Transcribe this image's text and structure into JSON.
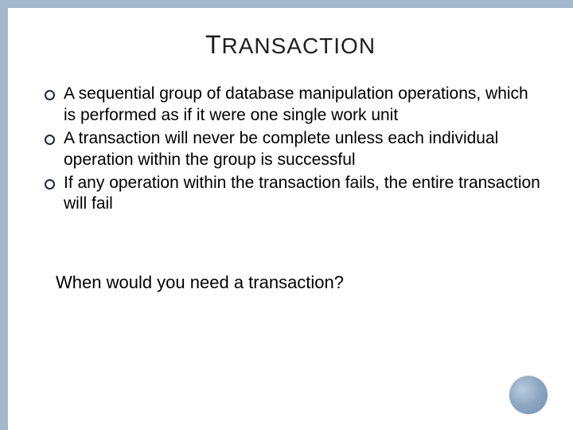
{
  "title": {
    "first_letter": "T",
    "rest": "RANSACTION"
  },
  "bullets": [
    "A sequential group of database manipulation operations, which is performed as if it were one single work unit",
    "A transaction will never be complete unless each individual operation within the group is successful",
    " If any operation within the transaction fails, the entire transaction will fail"
  ],
  "question": "When would you need a transaction?"
}
